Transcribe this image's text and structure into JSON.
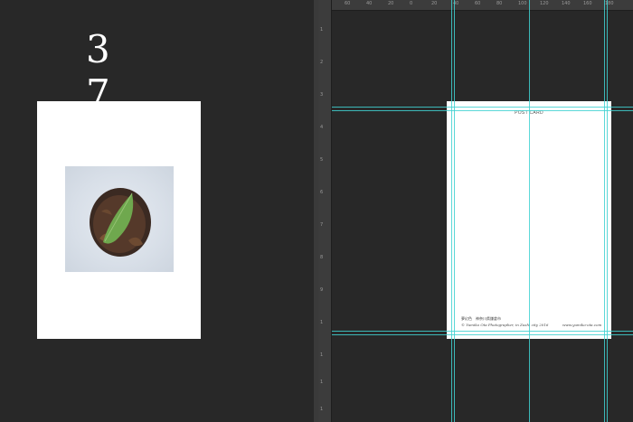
{
  "left_canvas": {
    "page_number": "3 7"
  },
  "right_canvas": {
    "ruler_labels": [
      "60",
      "40",
      "20",
      "0",
      "20",
      "40",
      "60",
      "80",
      "100",
      "120",
      "140",
      "160",
      "180"
    ],
    "vertical_ruler_labels": [
      "1",
      "2",
      "3",
      "4",
      "5",
      "6",
      "7",
      "8",
      "9",
      "1",
      "1",
      "1",
      "1"
    ],
    "back_card": {
      "postcard_label": "POST CARD",
      "caption_title": "夢幻色　神奈川県鎌倉市",
      "copyright": "© Yumiko Ota Photographer, in Zushi city 2016",
      "website": "www.yumiko-ota.com"
    }
  },
  "colors": {
    "workspace": "#282828",
    "guide": "#3fd1d1",
    "ruler": "#3c3c3c",
    "leaf": "#6fa84e"
  }
}
